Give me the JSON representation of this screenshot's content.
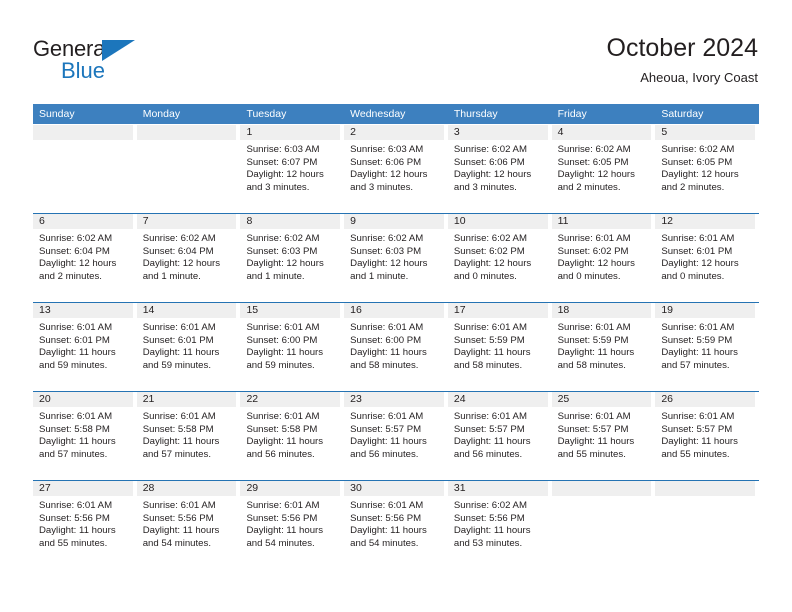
{
  "brand": {
    "word_one": "General",
    "word_two": "Blue",
    "triangle_icon": "brand-triangle-icon",
    "accent_color": "#1c76bc"
  },
  "header": {
    "title": "October 2024",
    "subtitle": "Aheoua, Ivory Coast"
  },
  "colors": {
    "weekday_header_bg": "#3d80bf",
    "week_divider": "#2573b3",
    "day_band_bg": "#efefef",
    "text": "#231f20"
  },
  "weekdays": [
    "Sunday",
    "Monday",
    "Tuesday",
    "Wednesday",
    "Thursday",
    "Friday",
    "Saturday"
  ],
  "weeks": [
    [
      {
        "day": "",
        "lines": []
      },
      {
        "day": "",
        "lines": []
      },
      {
        "day": "1",
        "lines": [
          "Sunrise: 6:03 AM",
          "Sunset: 6:07 PM",
          "Daylight: 12 hours",
          "and 3 minutes."
        ]
      },
      {
        "day": "2",
        "lines": [
          "Sunrise: 6:03 AM",
          "Sunset: 6:06 PM",
          "Daylight: 12 hours",
          "and 3 minutes."
        ]
      },
      {
        "day": "3",
        "lines": [
          "Sunrise: 6:02 AM",
          "Sunset: 6:06 PM",
          "Daylight: 12 hours",
          "and 3 minutes."
        ]
      },
      {
        "day": "4",
        "lines": [
          "Sunrise: 6:02 AM",
          "Sunset: 6:05 PM",
          "Daylight: 12 hours",
          "and 2 minutes."
        ]
      },
      {
        "day": "5",
        "lines": [
          "Sunrise: 6:02 AM",
          "Sunset: 6:05 PM",
          "Daylight: 12 hours",
          "and 2 minutes."
        ]
      }
    ],
    [
      {
        "day": "6",
        "lines": [
          "Sunrise: 6:02 AM",
          "Sunset: 6:04 PM",
          "Daylight: 12 hours",
          "and 2 minutes."
        ]
      },
      {
        "day": "7",
        "lines": [
          "Sunrise: 6:02 AM",
          "Sunset: 6:04 PM",
          "Daylight: 12 hours",
          "and 1 minute."
        ]
      },
      {
        "day": "8",
        "lines": [
          "Sunrise: 6:02 AM",
          "Sunset: 6:03 PM",
          "Daylight: 12 hours",
          "and 1 minute."
        ]
      },
      {
        "day": "9",
        "lines": [
          "Sunrise: 6:02 AM",
          "Sunset: 6:03 PM",
          "Daylight: 12 hours",
          "and 1 minute."
        ]
      },
      {
        "day": "10",
        "lines": [
          "Sunrise: 6:02 AM",
          "Sunset: 6:02 PM",
          "Daylight: 12 hours",
          "and 0 minutes."
        ]
      },
      {
        "day": "11",
        "lines": [
          "Sunrise: 6:01 AM",
          "Sunset: 6:02 PM",
          "Daylight: 12 hours",
          "and 0 minutes."
        ]
      },
      {
        "day": "12",
        "lines": [
          "Sunrise: 6:01 AM",
          "Sunset: 6:01 PM",
          "Daylight: 12 hours",
          "and 0 minutes."
        ]
      }
    ],
    [
      {
        "day": "13",
        "lines": [
          "Sunrise: 6:01 AM",
          "Sunset: 6:01 PM",
          "Daylight: 11 hours",
          "and 59 minutes."
        ]
      },
      {
        "day": "14",
        "lines": [
          "Sunrise: 6:01 AM",
          "Sunset: 6:01 PM",
          "Daylight: 11 hours",
          "and 59 minutes."
        ]
      },
      {
        "day": "15",
        "lines": [
          "Sunrise: 6:01 AM",
          "Sunset: 6:00 PM",
          "Daylight: 11 hours",
          "and 59 minutes."
        ]
      },
      {
        "day": "16",
        "lines": [
          "Sunrise: 6:01 AM",
          "Sunset: 6:00 PM",
          "Daylight: 11 hours",
          "and 58 minutes."
        ]
      },
      {
        "day": "17",
        "lines": [
          "Sunrise: 6:01 AM",
          "Sunset: 5:59 PM",
          "Daylight: 11 hours",
          "and 58 minutes."
        ]
      },
      {
        "day": "18",
        "lines": [
          "Sunrise: 6:01 AM",
          "Sunset: 5:59 PM",
          "Daylight: 11 hours",
          "and 58 minutes."
        ]
      },
      {
        "day": "19",
        "lines": [
          "Sunrise: 6:01 AM",
          "Sunset: 5:59 PM",
          "Daylight: 11 hours",
          "and 57 minutes."
        ]
      }
    ],
    [
      {
        "day": "20",
        "lines": [
          "Sunrise: 6:01 AM",
          "Sunset: 5:58 PM",
          "Daylight: 11 hours",
          "and 57 minutes."
        ]
      },
      {
        "day": "21",
        "lines": [
          "Sunrise: 6:01 AM",
          "Sunset: 5:58 PM",
          "Daylight: 11 hours",
          "and 57 minutes."
        ]
      },
      {
        "day": "22",
        "lines": [
          "Sunrise: 6:01 AM",
          "Sunset: 5:58 PM",
          "Daylight: 11 hours",
          "and 56 minutes."
        ]
      },
      {
        "day": "23",
        "lines": [
          "Sunrise: 6:01 AM",
          "Sunset: 5:57 PM",
          "Daylight: 11 hours",
          "and 56 minutes."
        ]
      },
      {
        "day": "24",
        "lines": [
          "Sunrise: 6:01 AM",
          "Sunset: 5:57 PM",
          "Daylight: 11 hours",
          "and 56 minutes."
        ]
      },
      {
        "day": "25",
        "lines": [
          "Sunrise: 6:01 AM",
          "Sunset: 5:57 PM",
          "Daylight: 11 hours",
          "and 55 minutes."
        ]
      },
      {
        "day": "26",
        "lines": [
          "Sunrise: 6:01 AM",
          "Sunset: 5:57 PM",
          "Daylight: 11 hours",
          "and 55 minutes."
        ]
      }
    ],
    [
      {
        "day": "27",
        "lines": [
          "Sunrise: 6:01 AM",
          "Sunset: 5:56 PM",
          "Daylight: 11 hours",
          "and 55 minutes."
        ]
      },
      {
        "day": "28",
        "lines": [
          "Sunrise: 6:01 AM",
          "Sunset: 5:56 PM",
          "Daylight: 11 hours",
          "and 54 minutes."
        ]
      },
      {
        "day": "29",
        "lines": [
          "Sunrise: 6:01 AM",
          "Sunset: 5:56 PM",
          "Daylight: 11 hours",
          "and 54 minutes."
        ]
      },
      {
        "day": "30",
        "lines": [
          "Sunrise: 6:01 AM",
          "Sunset: 5:56 PM",
          "Daylight: 11 hours",
          "and 54 minutes."
        ]
      },
      {
        "day": "31",
        "lines": [
          "Sunrise: 6:02 AM",
          "Sunset: 5:56 PM",
          "Daylight: 11 hours",
          "and 53 minutes."
        ]
      },
      {
        "day": "",
        "lines": []
      },
      {
        "day": "",
        "lines": []
      }
    ]
  ]
}
